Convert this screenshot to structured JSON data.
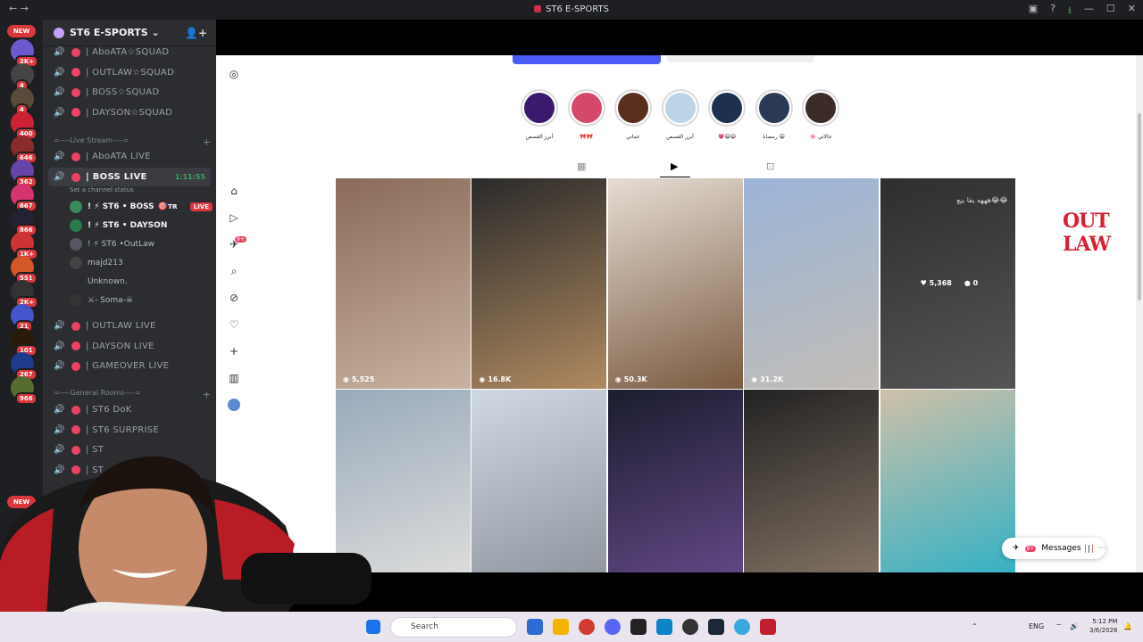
{
  "window": {
    "title": "ST6 E-SPORTS",
    "nav": "← →"
  },
  "servers": {
    "new_label": "NEW",
    "badges": [
      "2K+",
      "4",
      "4",
      "400",
      "646",
      "362",
      "667",
      "866",
      "1K+",
      "551",
      "2K+",
      "21",
      "101",
      "267",
      "966"
    ],
    "new_bottom": "NEW"
  },
  "guild": {
    "name": "ST6 E-SPORTS ⌄"
  },
  "channels": {
    "squads": [
      "| AboATA☆SQUAD",
      "| OUTLAW☆SQUAD",
      "| BOSS☆SQUAD",
      "| DAYSON☆SQUAD"
    ],
    "live_category": "=----Live Stream----=",
    "live_channels": [
      {
        "name": "| AboATA LIVE"
      },
      {
        "name": "| BOSS LIVE",
        "time": "1:11:55",
        "status": "Set a channel status"
      }
    ],
    "users": [
      {
        "name": "! ⚡ ST6 • BOSS",
        "tag": "🎯ᴛʀ",
        "live": "LIVE"
      },
      {
        "name": "! ⚡ ST6 • DAYSON"
      },
      {
        "name": "! ⚡ ST6 •OutLaw"
      },
      {
        "name": "majd213"
      },
      {
        "name": "Unknown."
      },
      {
        "name": "⚔- Soma-☠"
      }
    ],
    "live_channels2": [
      "| OUTLAW LIVE",
      "| DAYSON LIVE",
      "| GAMEOVER LIVE"
    ],
    "general_category": "=----General Rooms----=",
    "general": [
      "| ST6 DoK",
      "| ST6 SURPRISE",
      "| ST",
      "| ST"
    ]
  },
  "instagram": {
    "nav_badge": "9+",
    "stories": [
      "أبرز القصص",
      "🎀🎀",
      "عماني",
      "أبرز القصص",
      "💗😄😄",
      "رمضانا 😄",
      "🌸 حالاتي"
    ],
    "tiles": [
      {
        "views": "5,525",
        "c1": "#8a6a58",
        "c2": "#c9b3a0"
      },
      {
        "views": "16.8K",
        "c1": "#2a2a2a",
        "c2": "#b08a60"
      },
      {
        "views": "50.3K",
        "c1": "#e6ddd4",
        "c2": "#7a5a40"
      },
      {
        "views": "31.2K",
        "c1": "#9bb4d8",
        "c2": "#c2bdb6"
      },
      {
        "views": "",
        "c1": "#2e2e2e",
        "c2": "#555"
      },
      {
        "views": "",
        "c1": "#9ab",
        "c2": "#e4e2de"
      },
      {
        "views": "",
        "c1": "#cfd8e4",
        "c2": "#8a8f98"
      },
      {
        "views": "",
        "c1": "#1a1d2e",
        "c2": "#6a4c8e"
      },
      {
        "views": "",
        "c1": "#222",
        "c2": "#8c7a6a"
      },
      {
        "views": "",
        "c1": "#cfc0a8",
        "c2": "#23b0c8"
      }
    ],
    "hover_likes": "5,368",
    "hover_comments": "0",
    "tile5_caption": "هههه يقا بيع😂😂",
    "messages_label": "Messages",
    "messages_badge": "9+"
  },
  "overlay_logo": "OUT LAW",
  "taskbar": {
    "search": "Search",
    "lang": "ENG",
    "time": "5:12 PM",
    "date": "3/6/2026"
  }
}
